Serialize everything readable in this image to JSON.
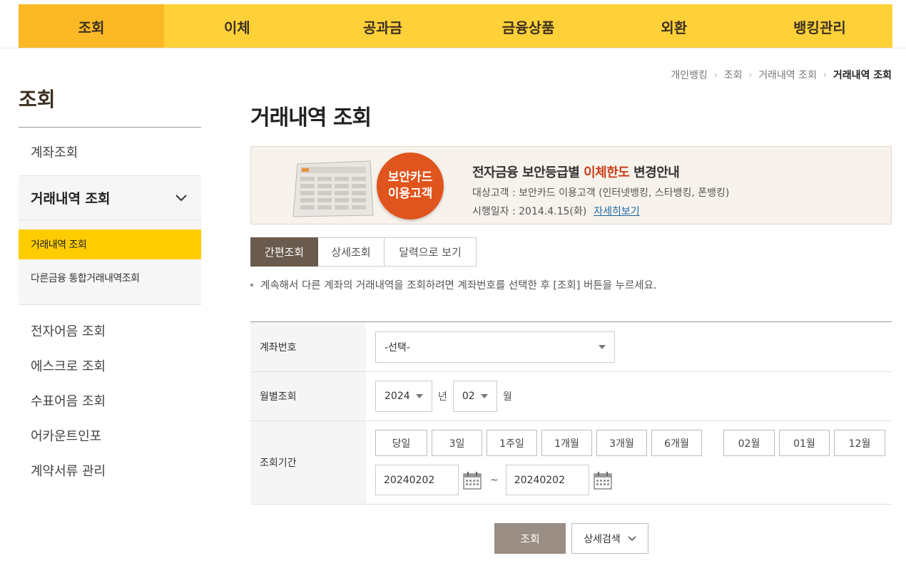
{
  "gnb": {
    "items": [
      {
        "label": "조회",
        "active": true
      },
      {
        "label": "이체",
        "active": false
      },
      {
        "label": "공과금",
        "active": false
      },
      {
        "label": "금융상품",
        "active": false
      },
      {
        "label": "외환",
        "active": false
      },
      {
        "label": "뱅킹관리",
        "active": false
      }
    ]
  },
  "breadcrumb": [
    "개인뱅킹",
    "조회",
    "거래내역 조회",
    "거래내역 조회"
  ],
  "sidebar": {
    "title": "조회",
    "first_item": "계좌조회",
    "group": {
      "label": "거래내역 조회",
      "sub_items": [
        {
          "label": "거래내역 조회",
          "active": true
        },
        {
          "label": "다른금융 통합거래내역조회",
          "active": false
        }
      ]
    },
    "rest_items": [
      "전자어음 조회",
      "에스크로 조회",
      "수표어음 조회",
      "어카운트인포",
      "계약서류 관리"
    ]
  },
  "main": {
    "title": "거래내역 조회",
    "banner": {
      "badge_line1": "보안카드",
      "badge_line2": "이용고객",
      "headline_pre": "전자금융 보안등급별 ",
      "headline_highlight": "이체한도",
      "headline_post": " 변경안내",
      "target_line": "대상고객 : 보안카드 이용고객 (인터넷뱅킹, 스타뱅킹, 폰뱅킹)",
      "date_line": "시행일자 : 2014.4.15(화)",
      "link_label": "자세히보기"
    },
    "tabs": [
      "간편조회",
      "상세조회",
      "달력으로 보기"
    ],
    "notice": "계속해서 다른 계좌의 거래내역을 조회하려면 계좌번호를 선택한 후 [조회] 버튼을 누르세요.",
    "form": {
      "account_label": "계좌번호",
      "account_value": "-선택-",
      "monthly_label": "월별조회",
      "year_value": "2024",
      "year_unit": "년",
      "month_value": "02",
      "month_unit": "월",
      "period_label": "조회기간",
      "period_buttons": [
        "당일",
        "3일",
        "1주일",
        "1개월",
        "3개월",
        "6개월"
      ],
      "month_buttons": [
        "02월",
        "01월",
        "12월"
      ],
      "start_date": "20240202",
      "end_date": "20240202",
      "tilde": "~"
    },
    "search_button": "조회",
    "detail_button": "상세검색"
  },
  "colors": {
    "gnb_bg": "#ffd139",
    "gnb_active": "#fbb925",
    "lnb_active": "#ffcc00",
    "tab_active": "#6b5b4e",
    "badge": "#e0541d",
    "search_button": "#998d84"
  }
}
